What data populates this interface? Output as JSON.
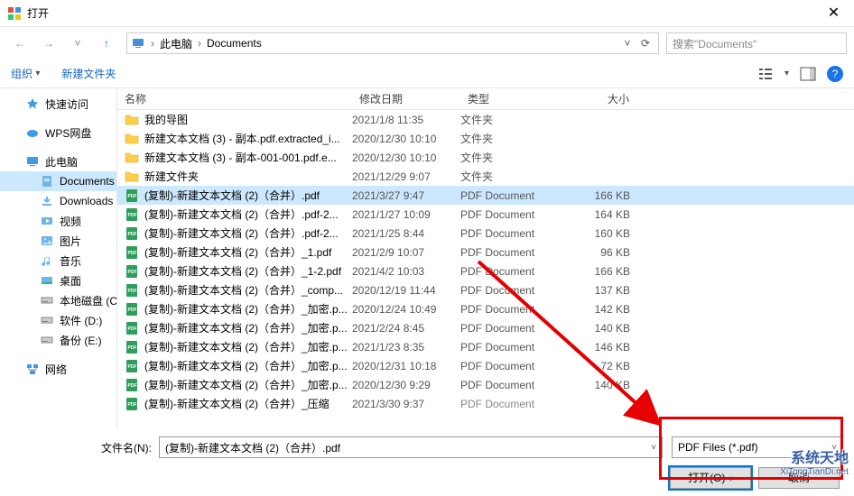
{
  "window": {
    "title": "打开",
    "close_glyph": "✕"
  },
  "nav_arrows": {
    "back": "←",
    "fwd": "→",
    "up": "↑",
    "dd": "˅"
  },
  "address": {
    "crumb1": "此电脑",
    "crumb2": "Documents",
    "sep": "›",
    "dd": "˅",
    "refresh": "⟳"
  },
  "search": {
    "placeholder": "搜索\"Documents\""
  },
  "toolbar": {
    "organize": "组织",
    "newfolder": "新建文件夹",
    "help": "?"
  },
  "navpane": {
    "items": [
      {
        "label": "快速访问",
        "icon": "star",
        "color": "#3b9de8"
      },
      {
        "label": "WPS网盘",
        "icon": "cloud",
        "color": "#3b9de8"
      },
      {
        "label": "此电脑",
        "icon": "pc",
        "color": "#3b9de8"
      },
      {
        "label": "Documents",
        "icon": "doc",
        "indent": true,
        "selected": true,
        "color": "#6fb5e8"
      },
      {
        "label": "Downloads",
        "icon": "down",
        "indent": true,
        "color": "#6fb5e8"
      },
      {
        "label": "视频",
        "icon": "video",
        "indent": true,
        "color": "#6fb5e8"
      },
      {
        "label": "图片",
        "icon": "pic",
        "indent": true,
        "color": "#6fb5e8"
      },
      {
        "label": "音乐",
        "icon": "music",
        "indent": true,
        "color": "#6fb5e8"
      },
      {
        "label": "桌面",
        "icon": "desk",
        "indent": true,
        "color": "#6fb5e8"
      },
      {
        "label": "本地磁盘 (C",
        "icon": "disk",
        "indent": true,
        "color": "#888"
      },
      {
        "label": "软件 (D:)",
        "icon": "disk",
        "indent": true,
        "color": "#888"
      },
      {
        "label": "备份 (E:)",
        "icon": "disk",
        "indent": true,
        "color": "#888"
      },
      {
        "label": "网络",
        "icon": "net",
        "color": "#3b9de8"
      }
    ]
  },
  "columns": {
    "name": "名称",
    "date": "修改日期",
    "type": "类型",
    "size": "大小"
  },
  "rows": [
    {
      "icon": "folder",
      "name": "我的导图",
      "date": "2021/1/8 11:35",
      "type": "文件夹",
      "size": ""
    },
    {
      "icon": "folder",
      "name": "新建文本文档 (3) - 副本.pdf.extracted_i...",
      "date": "2020/12/30 10:10",
      "type": "文件夹",
      "size": ""
    },
    {
      "icon": "folder",
      "name": "新建文本文档 (3) - 副本-001-001.pdf.e...",
      "date": "2020/12/30 10:10",
      "type": "文件夹",
      "size": ""
    },
    {
      "icon": "folder",
      "name": "新建文件夹",
      "date": "2021/12/29 9:07",
      "type": "文件夹",
      "size": ""
    },
    {
      "icon": "pdf",
      "name": "(复制)-新建文本文档 (2)（合并）.pdf",
      "date": "2021/3/27 9:47",
      "type": "PDF Document",
      "size": "166 KB",
      "selected": true
    },
    {
      "icon": "pdf",
      "name": "(复制)-新建文本文档 (2)（合并）.pdf-2...",
      "date": "2021/1/27 10:09",
      "type": "PDF Document",
      "size": "164 KB"
    },
    {
      "icon": "pdf",
      "name": "(复制)-新建文本文档 (2)（合并）.pdf-2...",
      "date": "2021/1/25 8:44",
      "type": "PDF Document",
      "size": "160 KB"
    },
    {
      "icon": "pdf",
      "name": "(复制)-新建文本文档 (2)（合并）_1.pdf",
      "date": "2021/2/9 10:07",
      "type": "PDF Document",
      "size": "96 KB"
    },
    {
      "icon": "pdf",
      "name": "(复制)-新建文本文档 (2)（合并）_1-2.pdf",
      "date": "2021/4/2 10:03",
      "type": "PDF Document",
      "size": "166 KB"
    },
    {
      "icon": "pdf",
      "name": "(复制)-新建文本文档 (2)（合并）_comp...",
      "date": "2020/12/19 11:44",
      "type": "PDF Document",
      "size": "137 KB"
    },
    {
      "icon": "pdf",
      "name": "(复制)-新建文本文档 (2)（合并）_加密.p...",
      "date": "2020/12/24 10:49",
      "type": "PDF Document",
      "size": "142 KB"
    },
    {
      "icon": "pdf",
      "name": "(复制)-新建文本文档 (2)（合并）_加密.p...",
      "date": "2021/2/24 8:45",
      "type": "PDF Document",
      "size": "140 KB"
    },
    {
      "icon": "pdf",
      "name": "(复制)-新建文本文档 (2)（合并）_加密.p...",
      "date": "2021/1/23 8:35",
      "type": "PDF Document",
      "size": "146 KB"
    },
    {
      "icon": "pdf",
      "name": "(复制)-新建文本文档 (2)（合并）_加密.p...",
      "date": "2020/12/31 10:18",
      "type": "PDF Document",
      "size": "72 KB"
    },
    {
      "icon": "pdf",
      "name": "(复制)-新建文本文档 (2)（合并）_加密.p...",
      "date": "2020/12/30 9:29",
      "type": "PDF Document",
      "size": "140 KB"
    },
    {
      "icon": "pdf",
      "name": "(复制)-新建文本文档 (2)（合并）_压缩",
      "date": "2021/3/30 9:37",
      "type": "PDF Document",
      "size": "",
      "cutoff": true
    }
  ],
  "footer": {
    "filename_label": "文件名(N):",
    "filename_value": "(复制)-新建文本文档 (2)（合并）.pdf",
    "filetype_value": "PDF Files (*.pdf)",
    "open_label": "打开(O)",
    "cancel_label": "取消",
    "caret": "˅",
    "split": "▾"
  },
  "watermark": {
    "line1": "系统天地",
    "line2": "XiTongTianDi.net"
  }
}
